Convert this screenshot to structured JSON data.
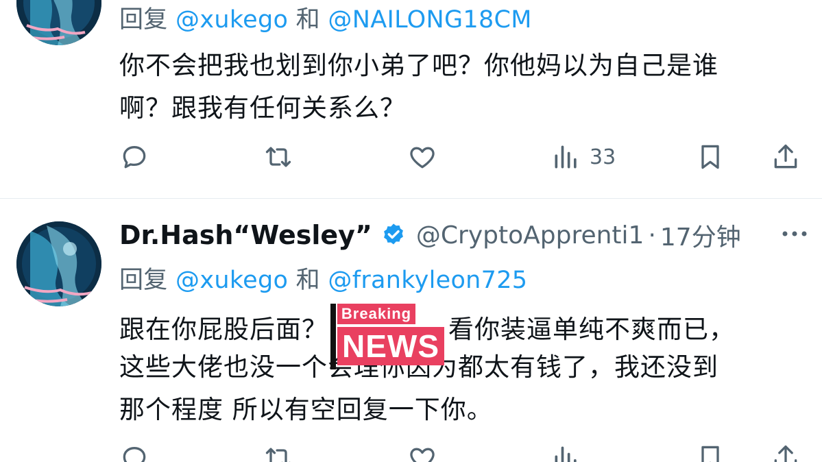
{
  "tweet1": {
    "reply_prefix": "回复",
    "mention1": "@xukego",
    "conj": "和",
    "mention2": "@NAILONG18CM",
    "lines": [
      "你不会把我也划到你小弟了吧？你他妈以为自己是谁",
      "啊？跟我有任何关系么？"
    ],
    "views": "33"
  },
  "tweet2": {
    "display_name": "Dr.Hash“Wesley”",
    "handle": "@CryptoApprenti1",
    "separator": "·",
    "timestamp": "17分钟",
    "reply_prefix": "回复",
    "mention1": "@xukego",
    "conj": "和",
    "mention2": "@frankyleon725",
    "line1_before": "跟在你屁股后面？",
    "line1_after": "看你装逼单纯不爽而已，",
    "line2": "这些大佬也没一个会理你因为都太有钱了，我还没到",
    "line3": "那个程度 所以有空回复一下你。",
    "badge_top": "Breaking",
    "badge_bottom": "NEWS"
  },
  "colors": {
    "accent": "#1d9bf0",
    "secondary_text": "#536471",
    "badge": "#e94060"
  },
  "icons": [
    "reply-icon",
    "retweet-icon",
    "like-icon",
    "views-icon",
    "bookmark-icon",
    "share-icon",
    "verified-icon",
    "more-icon"
  ]
}
